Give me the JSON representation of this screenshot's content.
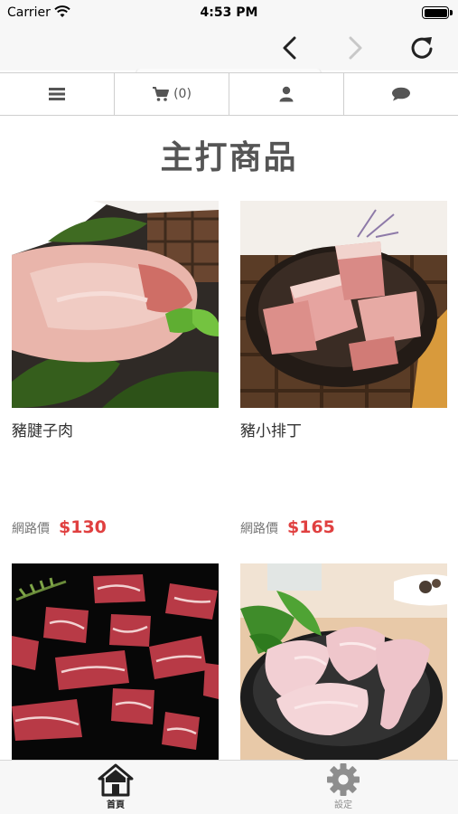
{
  "status_bar": {
    "carrier": "Carrier",
    "time": "4:53 PM"
  },
  "browser": {
    "icons": [
      "chevron-left-icon",
      "chevron-right-icon",
      "reload-icon"
    ]
  },
  "nav": {
    "cart_count": "(0)",
    "icons": [
      "menu-icon",
      "cart-icon",
      "user-icon",
      "chat-icon"
    ]
  },
  "page": {
    "title": "主打商品"
  },
  "products": [
    {
      "name": "豬腱子肉",
      "price_label": "網路價",
      "price": "$130"
    },
    {
      "name": "豬小排丁",
      "price_label": "網路價",
      "price": "$165"
    },
    {
      "name": "",
      "price_label": "",
      "price": ""
    },
    {
      "name": "",
      "price_label": "",
      "price": ""
    }
  ],
  "tabs": [
    {
      "label": "首頁",
      "icon": "home-icon",
      "active": true
    },
    {
      "label": "設定",
      "icon": "gear-icon",
      "active": false
    }
  ],
  "colors": {
    "price": "#e04040",
    "bar_bg": "#f7f7f7",
    "title": "#555555"
  }
}
